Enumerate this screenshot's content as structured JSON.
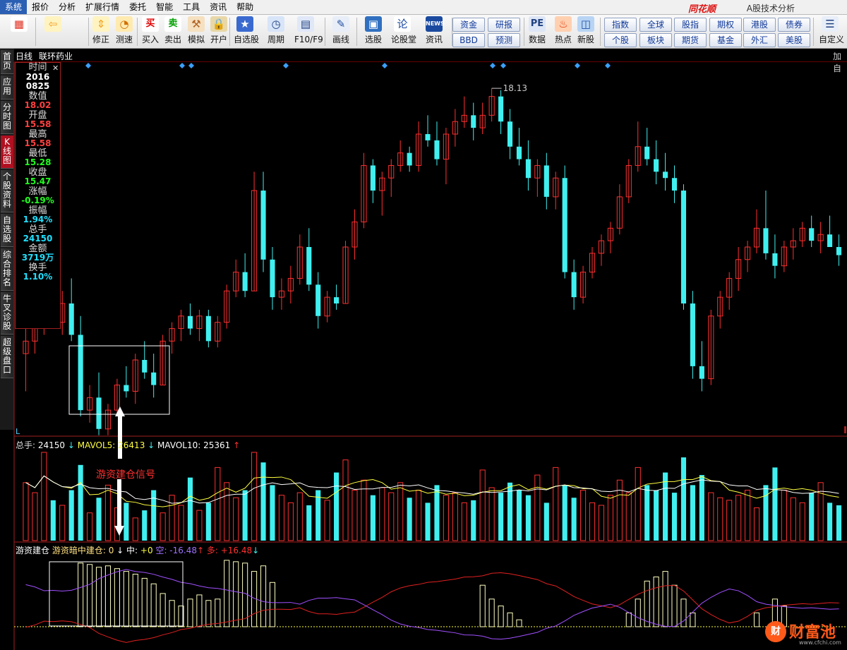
{
  "menu": [
    "系统",
    "报价",
    "分析",
    "扩展行情",
    "委托",
    "智能",
    "工具",
    "资讯",
    "帮助"
  ],
  "brand": "同花顺",
  "app_title": "A股技术分析",
  "toolbar": {
    "items": [
      {
        "label": "",
        "icon": "color-grid-icon"
      },
      {
        "label": "",
        "icon": "back-arrow-icon"
      },
      {
        "label": "修正",
        "icon": "up-down-arrow-icon"
      },
      {
        "label": "测速",
        "icon": "clock-icon"
      },
      {
        "label": "买入",
        "icon": "buy-icon",
        "glyph": "买"
      },
      {
        "label": "卖出",
        "icon": "sell-icon",
        "glyph": "卖"
      },
      {
        "label": "模拟",
        "icon": "hammer-icon"
      },
      {
        "label": "开户",
        "icon": "lock-icon"
      },
      {
        "label": "自选股",
        "icon": "star-icon"
      },
      {
        "label": "周期",
        "icon": "cycle-icon"
      },
      {
        "label": "F10/F9",
        "icon": "f10-icon"
      },
      {
        "label": "画线",
        "icon": "pen-icon"
      },
      {
        "label": "选股",
        "icon": "select-stock-icon"
      },
      {
        "label": "论股堂",
        "icon": "forum-icon"
      },
      {
        "label": "资讯",
        "icon": "news-icon",
        "glyph": "NEWS"
      },
      {
        "label": "数据",
        "icon": "pe-icon",
        "glyph": "PE"
      },
      {
        "label": "热点",
        "icon": "hot-icon"
      },
      {
        "label": "新股",
        "icon": "new-stock-icon"
      },
      {
        "label": "自定义",
        "icon": "customize-icon"
      }
    ],
    "grid_buttons": [
      "资金",
      "研报",
      "BBD",
      "预测",
      "指数",
      "全球",
      "股指",
      "期权",
      "港股",
      "债券",
      "个股",
      "板块",
      "期货",
      "基金",
      "外汇",
      "美股"
    ]
  },
  "left_nav": [
    "首页",
    "应用",
    "分时图",
    "K线图",
    "个股资料",
    "自选股",
    "综合排名",
    "牛叉诊股",
    "超级盘口"
  ],
  "chart_header": {
    "period": "日线",
    "stock": "联环药业",
    "right_tab": "加自"
  },
  "info_panel": [
    {
      "k": "时间",
      "v": "2016",
      "v2": "0825",
      "c": "wht"
    },
    {
      "k": "数值",
      "v": "18.02",
      "c": "red"
    },
    {
      "k": "开盘",
      "v": "15.58",
      "c": "red"
    },
    {
      "k": "最高",
      "v": "15.58",
      "c": "red"
    },
    {
      "k": "最低",
      "v": "15.28",
      "c": "grn"
    },
    {
      "k": "收盘",
      "v": "15.47",
      "c": "grn"
    },
    {
      "k": "涨幅",
      "v": "-0.19%",
      "c": "grn"
    },
    {
      "k": "振幅",
      "v": "1.94%",
      "c": "cya"
    },
    {
      "k": "总手",
      "v": "24150",
      "c": "cya"
    },
    {
      "k": "金额",
      "v": "3719万",
      "c": "cya"
    },
    {
      "k": "换手",
      "v": "1.10%",
      "c": "cya"
    }
  ],
  "price_max_label": "18.13",
  "volume_header": {
    "a_label": "总手: ",
    "a_val": "24150",
    "b_label": "MAVOL5: ",
    "b_val": "26413",
    "c_label": "MAVOL10: ",
    "c_val": "25361"
  },
  "indicator_header": {
    "t1": "游资建仓",
    "t2": "游资暗中建仓: 0",
    "mid_label": "中: ",
    "mid": "+0",
    "empty_label": "空: ",
    "empty": "-16.48",
    "long_label": "多: ",
    "long": "+16.48"
  },
  "annotation": "游资建仓信号",
  "axis_marker": "L",
  "watermark": {
    "glyph": "财",
    "text": "财富池",
    "url": "www.cfchi.com"
  },
  "colors": {
    "up": "#ff3030",
    "down": "#40f0f0",
    "ma5": "#ffff40",
    "ma10": "#ffffff",
    "accent": "#2a5fb3"
  },
  "chart_data": {
    "type": "candlestick",
    "ylim": [
      12.9,
      18.3
    ],
    "candles": [
      [
        13.9,
        14.3,
        13.3,
        14.1
      ],
      [
        14.1,
        14.6,
        13.9,
        14.4
      ],
      [
        14.4,
        15.3,
        14.2,
        15.0
      ],
      [
        15.0,
        15.2,
        14.3,
        14.4
      ],
      [
        14.4,
        14.9,
        14.2,
        14.7
      ],
      [
        14.7,
        15.1,
        14.1,
        14.2
      ],
      [
        14.2,
        14.5,
        12.9,
        13.0
      ],
      [
        13.0,
        13.4,
        12.8,
        13.2
      ],
      [
        13.2,
        13.6,
        12.6,
        12.7
      ],
      [
        12.7,
        13.1,
        12.6,
        13.0
      ],
      [
        13.0,
        13.5,
        12.9,
        13.4
      ],
      [
        13.4,
        13.7,
        13.2,
        13.3
      ],
      [
        13.3,
        13.9,
        13.1,
        13.8
      ],
      [
        13.8,
        14.1,
        13.5,
        13.6
      ],
      [
        13.6,
        13.9,
        13.2,
        13.4
      ],
      [
        13.4,
        14.2,
        13.4,
        14.1
      ],
      [
        14.1,
        14.4,
        13.9,
        14.3
      ],
      [
        14.3,
        14.6,
        14.1,
        14.5
      ],
      [
        14.5,
        14.7,
        14.2,
        14.3
      ],
      [
        14.3,
        14.6,
        14.1,
        14.5
      ],
      [
        14.5,
        14.6,
        14.0,
        14.1
      ],
      [
        14.1,
        14.5,
        14.0,
        14.4
      ],
      [
        14.4,
        15.0,
        14.3,
        14.9
      ],
      [
        14.9,
        15.4,
        14.8,
        15.2
      ],
      [
        15.2,
        15.5,
        14.8,
        14.9
      ],
      [
        14.9,
        16.8,
        14.9,
        16.5
      ],
      [
        16.5,
        16.8,
        15.2,
        15.4
      ],
      [
        15.4,
        15.6,
        14.6,
        14.8
      ],
      [
        14.8,
        15.1,
        14.6,
        14.9
      ],
      [
        14.9,
        15.3,
        14.7,
        15.1
      ],
      [
        15.1,
        15.8,
        15.0,
        15.6
      ],
      [
        15.6,
        15.9,
        14.9,
        15.0
      ],
      [
        15.0,
        15.2,
        14.3,
        14.5
      ],
      [
        14.5,
        14.9,
        14.4,
        14.8
      ],
      [
        14.8,
        15.0,
        14.6,
        14.7
      ],
      [
        14.7,
        15.7,
        14.7,
        15.6
      ],
      [
        15.6,
        16.2,
        15.4,
        16.0
      ],
      [
        16.0,
        17.1,
        15.9,
        16.9
      ],
      [
        16.9,
        17.0,
        16.3,
        16.5
      ],
      [
        16.5,
        16.8,
        16.1,
        16.7
      ],
      [
        16.7,
        17.0,
        16.4,
        16.9
      ],
      [
        16.9,
        17.3,
        16.8,
        17.1
      ],
      [
        17.1,
        17.2,
        16.8,
        16.9
      ],
      [
        16.9,
        17.6,
        16.8,
        17.4
      ],
      [
        17.4,
        17.7,
        17.2,
        17.3
      ],
      [
        17.3,
        17.6,
        16.9,
        17.0
      ],
      [
        17.0,
        17.5,
        16.6,
        17.4
      ],
      [
        17.4,
        17.8,
        17.2,
        17.6
      ],
      [
        17.6,
        18.0,
        17.5,
        17.7
      ],
      [
        17.7,
        17.9,
        17.3,
        17.5
      ],
      [
        17.5,
        17.9,
        17.4,
        17.7
      ],
      [
        17.7,
        18.13,
        17.6,
        18.0
      ],
      [
        18.0,
        18.1,
        17.4,
        17.6
      ],
      [
        17.6,
        17.8,
        17.0,
        17.2
      ],
      [
        17.2,
        17.5,
        16.9,
        17.0
      ],
      [
        17.0,
        17.3,
        16.5,
        16.7
      ],
      [
        16.7,
        17.0,
        16.4,
        16.9
      ],
      [
        16.9,
        17.1,
        16.2,
        16.4
      ],
      [
        16.4,
        16.8,
        16.2,
        16.7
      ],
      [
        16.7,
        16.9,
        15.1,
        15.2
      ],
      [
        15.2,
        15.4,
        14.6,
        14.8
      ],
      [
        14.8,
        15.3,
        14.7,
        15.2
      ],
      [
        15.2,
        15.6,
        15.1,
        15.5
      ],
      [
        15.5,
        15.8,
        15.3,
        15.7
      ],
      [
        15.7,
        16.0,
        15.5,
        15.9
      ],
      [
        15.9,
        16.6,
        15.8,
        16.4
      ],
      [
        16.4,
        17.0,
        16.3,
        16.9
      ],
      [
        16.9,
        17.6,
        16.8,
        17.2
      ],
      [
        17.2,
        17.5,
        16.9,
        17.0
      ],
      [
        17.0,
        17.3,
        16.6,
        16.8
      ],
      [
        16.8,
        17.1,
        16.5,
        16.7
      ],
      [
        16.7,
        16.9,
        16.3,
        16.5
      ],
      [
        16.5,
        16.6,
        14.6,
        14.7
      ],
      [
        14.7,
        14.9,
        13.5,
        13.7
      ],
      [
        13.7,
        14.1,
        13.3,
        13.5
      ],
      [
        13.5,
        14.6,
        13.4,
        14.5
      ],
      [
        14.5,
        14.9,
        14.3,
        14.8
      ],
      [
        14.8,
        15.2,
        14.6,
        15.1
      ],
      [
        15.1,
        15.6,
        14.9,
        15.4
      ],
      [
        15.4,
        15.7,
        15.2,
        15.6
      ],
      [
        15.6,
        16.2,
        15.5,
        15.9
      ],
      [
        15.9,
        16.5,
        15.4,
        15.5
      ],
      [
        15.5,
        15.8,
        15.1,
        15.3
      ],
      [
        15.3,
        15.7,
        15.2,
        15.6
      ],
      [
        15.6,
        15.9,
        15.4,
        15.7
      ],
      [
        15.7,
        16.0,
        15.6,
        15.9
      ],
      [
        15.9,
        16.1,
        15.6,
        15.7
      ],
      [
        15.7,
        16.0,
        15.5,
        15.8
      ],
      [
        15.8,
        16.1,
        15.6,
        15.6
      ],
      [
        15.6,
        15.8,
        15.3,
        15.47
      ]
    ],
    "volume": [
      46,
      38,
      70,
      32,
      28,
      40,
      60,
      22,
      34,
      44,
      26,
      30,
      18,
      24,
      40,
      22,
      36,
      28,
      50,
      24,
      30,
      58,
      46,
      34,
      40,
      70,
      62,
      44,
      36,
      30,
      38,
      28,
      40,
      32,
      54,
      64,
      40,
      48,
      36,
      42,
      38,
      46,
      34,
      40,
      30,
      44,
      36,
      38,
      30,
      32,
      56,
      42,
      38,
      46,
      40,
      36,
      52,
      30,
      58,
      44,
      34,
      40,
      30,
      28,
      36,
      48,
      38,
      58,
      44,
      40,
      54,
      38,
      66,
      44,
      52,
      38,
      34,
      32,
      36,
      40,
      26,
      44,
      58,
      40,
      34,
      30,
      38,
      46,
      30,
      28
    ],
    "indicator": [
      0,
      0,
      0,
      0,
      0,
      0,
      92,
      90,
      86,
      88,
      84,
      80,
      76,
      70,
      62,
      48,
      38,
      30,
      40,
      46,
      38,
      40,
      96,
      94,
      92,
      80,
      88,
      64,
      0,
      0,
      0,
      0,
      0,
      0,
      0,
      0,
      0,
      0,
      0,
      0,
      0,
      0,
      0,
      0,
      0,
      0,
      0,
      0,
      0,
      0,
      60,
      40,
      30,
      20,
      10,
      0,
      0,
      0,
      0,
      0,
      0,
      0,
      0,
      0,
      0,
      0,
      20,
      40,
      66,
      72,
      80,
      60,
      40,
      20,
      0,
      0,
      0,
      0,
      0,
      0,
      20,
      0,
      40,
      30,
      0,
      0,
      0,
      0,
      0,
      0
    ]
  }
}
